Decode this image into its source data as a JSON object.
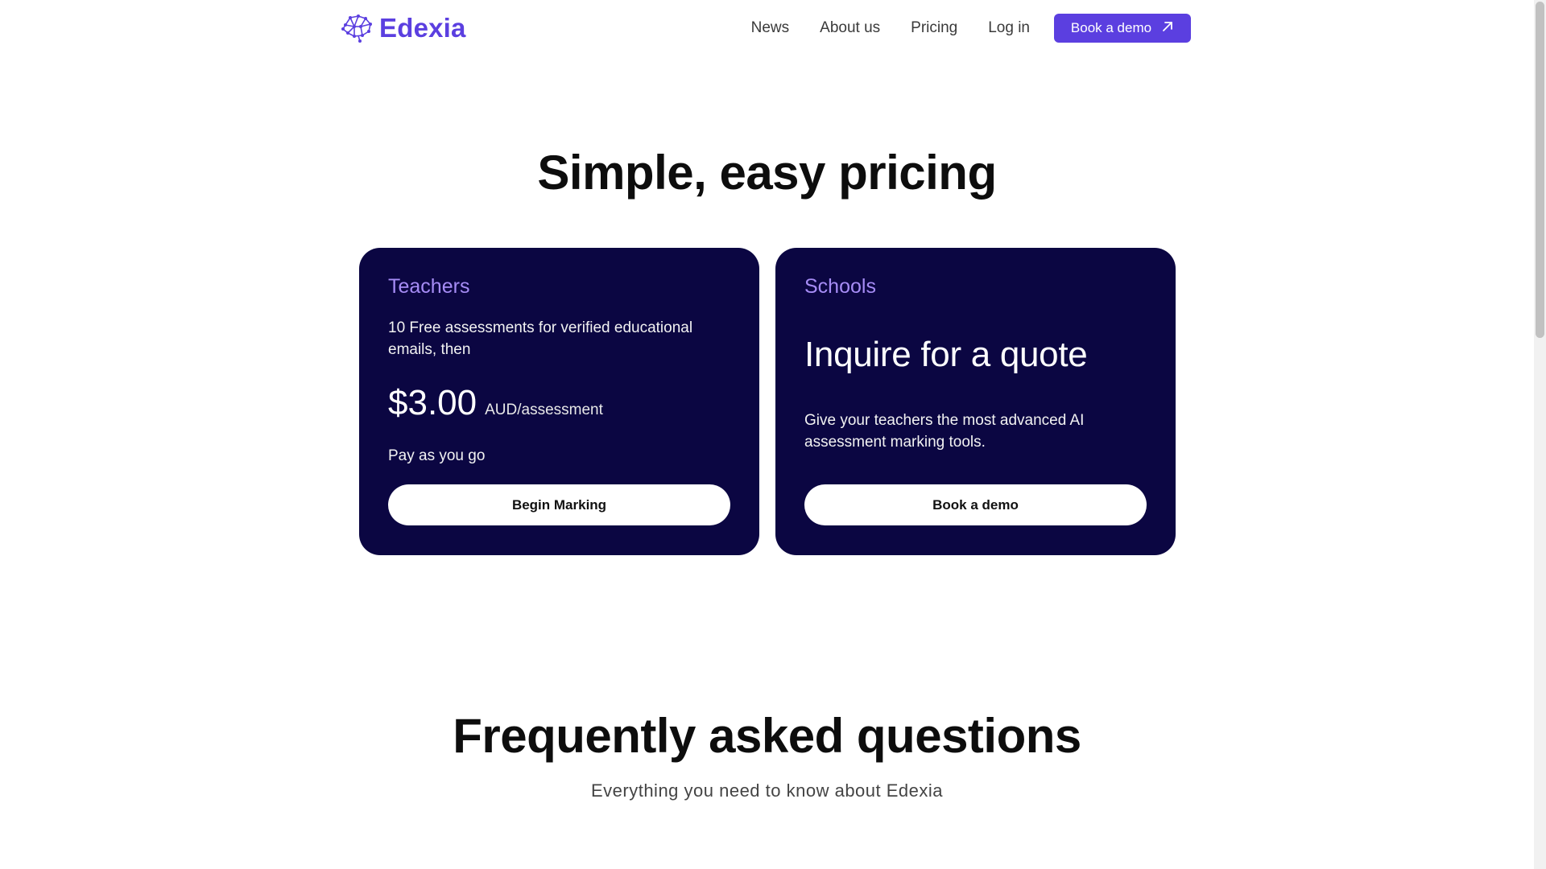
{
  "header": {
    "logo_text": "Edexia",
    "nav": {
      "news": "News",
      "about": "About us",
      "pricing": "Pricing",
      "login": "Log in"
    },
    "demo_button": "Book a demo",
    "brand_color": "#5b3fe0"
  },
  "pricing": {
    "title": "Simple, easy pricing",
    "teachers": {
      "title": "Teachers",
      "description": "10 Free assessments for verified educational emails, then",
      "price": "$3.00",
      "price_unit": "AUD/assessment",
      "note": "Pay as you go",
      "button": "Begin Marking"
    },
    "schools": {
      "title": "Schools",
      "headline": "Inquire for a quote",
      "description": "Give your teachers the most advanced AI assessment marking tools.",
      "button": "Book a demo"
    },
    "card_color": "#0b0642",
    "accent_color": "#a68cf5"
  },
  "faq": {
    "title": "Frequently asked questions",
    "subtitle": "Everything you need to know about Edexia"
  }
}
